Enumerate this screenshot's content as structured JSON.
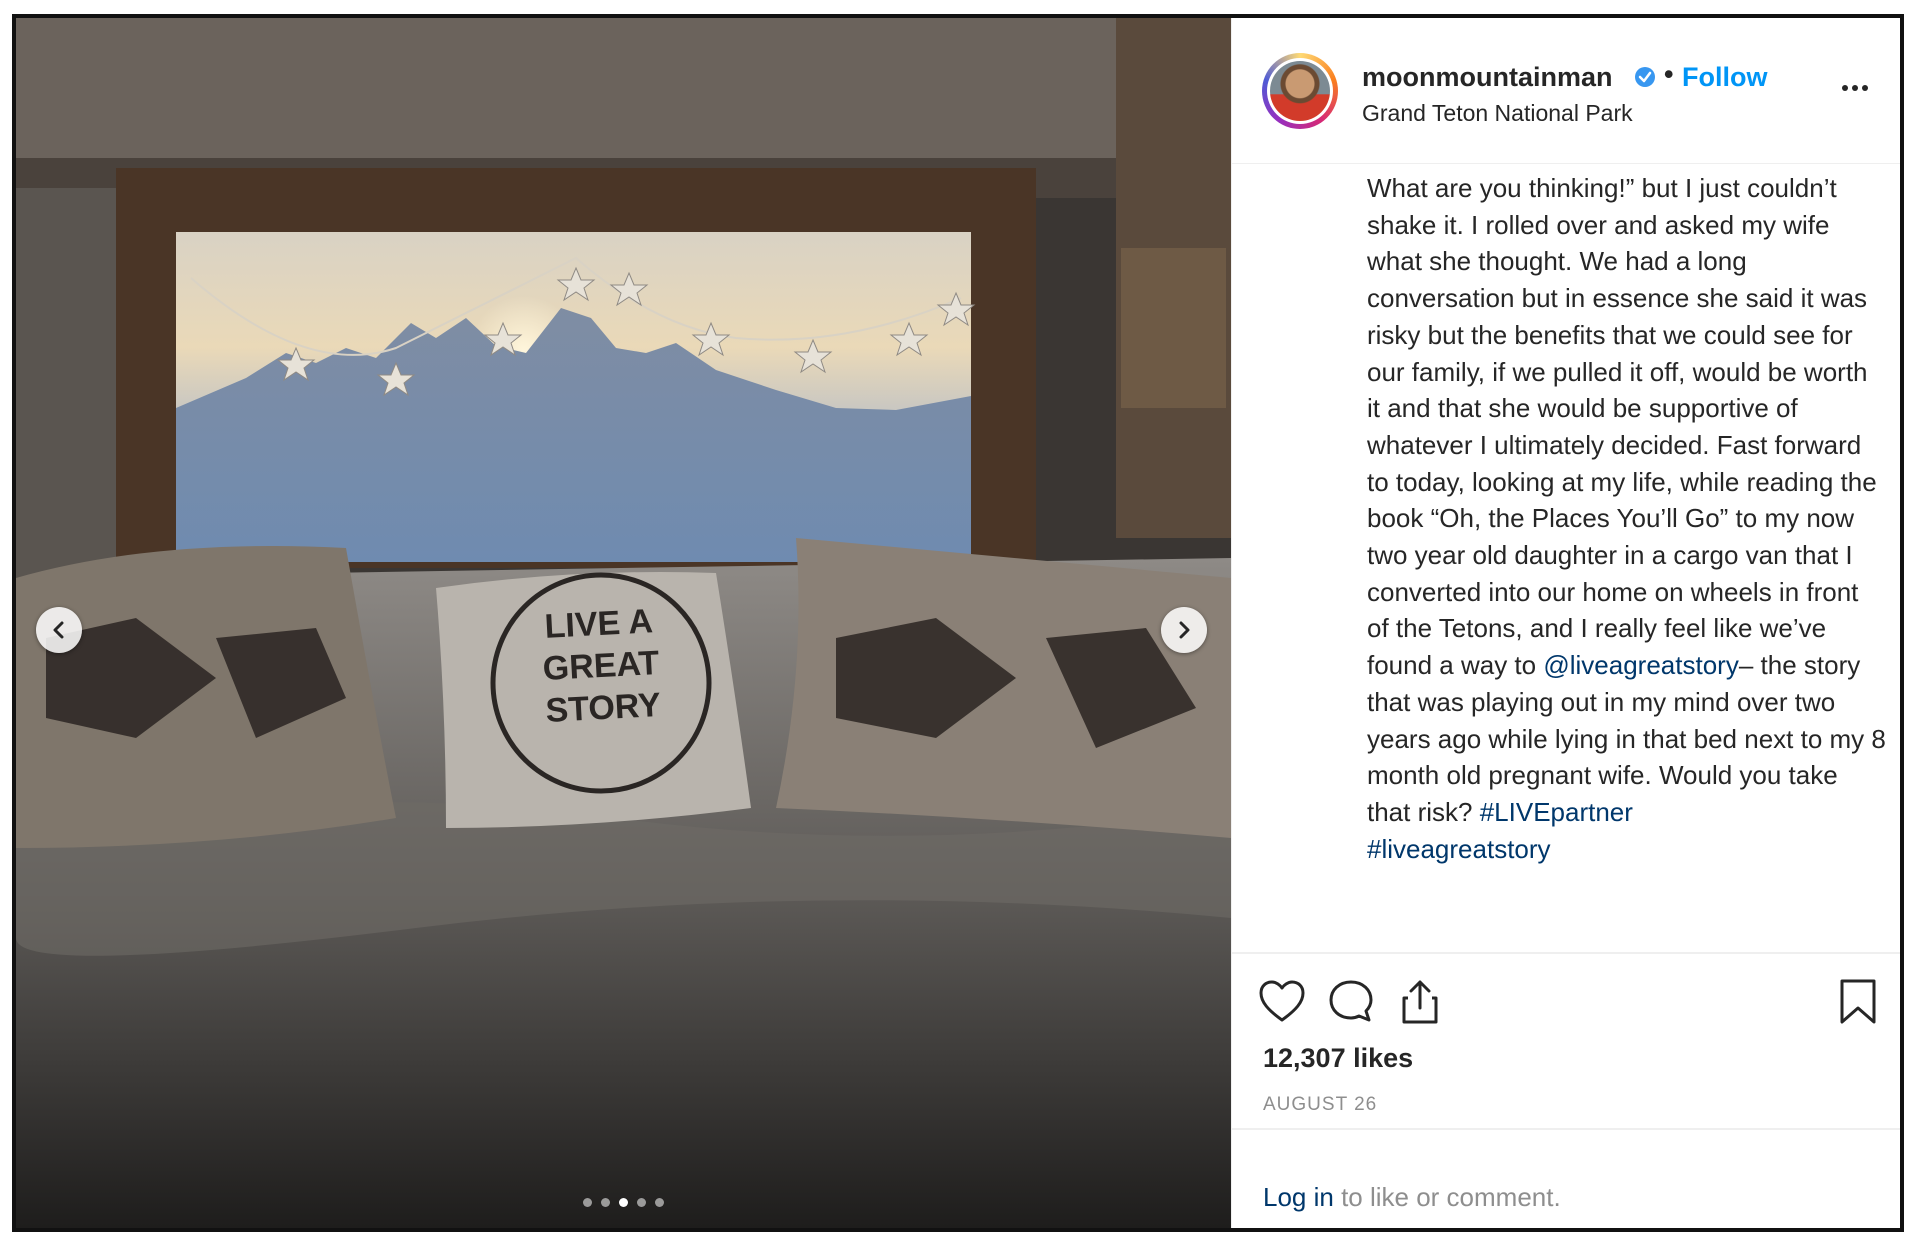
{
  "post": {
    "username": "moonmountainman",
    "separator": "•",
    "follow_label": "Follow",
    "location": "Grand Teton National Park",
    "caption_parts": {
      "p1": "What are you thinking!” but I just couldn’t shake it. I rolled over and asked my wife what she thought. We had a long conversation but in essence she said it was risky but the benefits that we could see for our family, if we pulled it off, would be worth it and that she would be supportive of whatever I ultimately decided. Fast forward to today, looking at my life, while reading the book “Oh, the Places You’ll Go” to my now two year old daughter in a cargo van that I converted into our home on wheels in front of the Tetons, and I really feel like we’ve found a way to ",
      "mention": "@liveagreatstory",
      "p2": "– the story that was playing out in my mind over two years ago while lying in that bed next to my 8 month old pregnant wife. Would you take that risk? ",
      "hashtag1": "#LIVEpartner",
      "hashtag2": "#liveagreatstory"
    },
    "likes": "12,307 likes",
    "date": "AUGUST 26",
    "login_link": "Log in",
    "login_suffix": " to like or comment."
  },
  "photo": {
    "pillow_text_lines": [
      "LIVE A",
      "GREAT",
      "STORY"
    ],
    "carousel_total": 5,
    "carousel_active_index": 3
  },
  "colors": {
    "accent_link": "#0095f6",
    "mention_link": "#00376b",
    "muted": "#8e8e8e"
  },
  "icons": [
    "chevron-left-icon",
    "chevron-right-icon",
    "verified-badge-icon",
    "more-options-icon",
    "heart-icon",
    "comment-icon",
    "share-icon",
    "bookmark-icon"
  ]
}
